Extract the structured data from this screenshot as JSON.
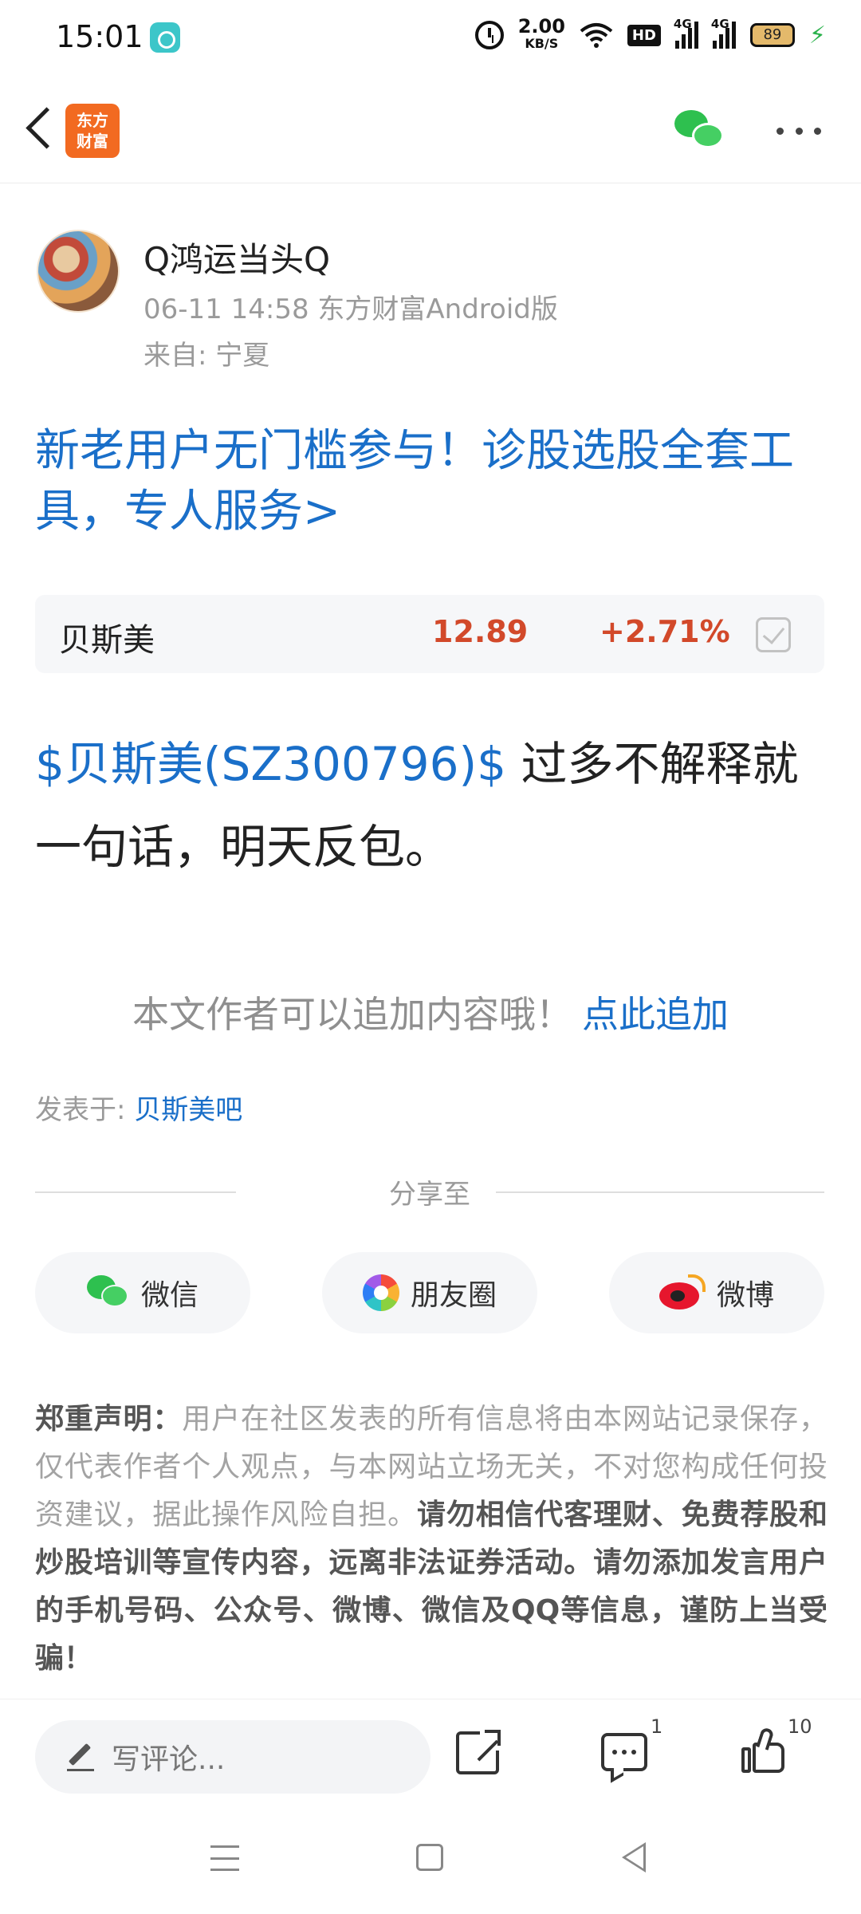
{
  "status_bar": {
    "time": "15:01",
    "net_speed_value": "2.00",
    "net_speed_unit": "KB/S",
    "hd_label": "HD",
    "signal_1_label": "4G",
    "signal_2_label": "4G",
    "battery": "89",
    "icons": [
      "app-notification-icon",
      "alarm-icon",
      "wifi-icon",
      "hd-icon",
      "signal-icon",
      "battery-icon",
      "charging-icon"
    ]
  },
  "header": {
    "logo_line1": "东方",
    "logo_line2": "财富",
    "icons": [
      "back-icon",
      "wechat-icon",
      "more-icon"
    ]
  },
  "post": {
    "author": "Q鸿运当头Q",
    "meta": "06-11 14:58 东方财富Android版",
    "from": "来自: 宁夏",
    "promo": "新老用户无门槛参与！诊股选股全套工具，专人服务>",
    "stock": {
      "name": "贝斯美",
      "price": "12.89",
      "change": "+2.71%"
    },
    "body_stock_link": "$贝斯美(SZ300796)$",
    "body_text": " 过多不解释就一句话，明天反包。",
    "append_text": "本文作者可以追加内容哦！",
    "append_link": "点此追加",
    "posted_in_label": "发表于: ",
    "posted_in_link": "贝斯美吧"
  },
  "share": {
    "label": "分享至",
    "buttons": [
      {
        "label": "微信",
        "icon": "wechat-icon"
      },
      {
        "label": "朋友圈",
        "icon": "moments-icon"
      },
      {
        "label": "微博",
        "icon": "weibo-icon"
      }
    ]
  },
  "disclaimer": {
    "title": "郑重声明：",
    "text": "用户在社区发表的所有信息将由本网站记录保存，仅代表作者个人观点，与本网站立场无关，不对您构成任何投资建议，据此操作风险自担。",
    "warning": "请勿相信代客理财、免费荐股和炒股培训等宣传内容，远离非法证券活动。请勿添加发言用户的手机号码、公众号、微博、微信及QQ等信息，谨防上当受骗！"
  },
  "bottom_bar": {
    "comment_placeholder": "写评论...",
    "comment_count": "1",
    "like_count": "10"
  },
  "colors": {
    "link_blue": "#1a6fc9",
    "up_red": "#d2492a",
    "brand_orange": "#f26a21"
  }
}
